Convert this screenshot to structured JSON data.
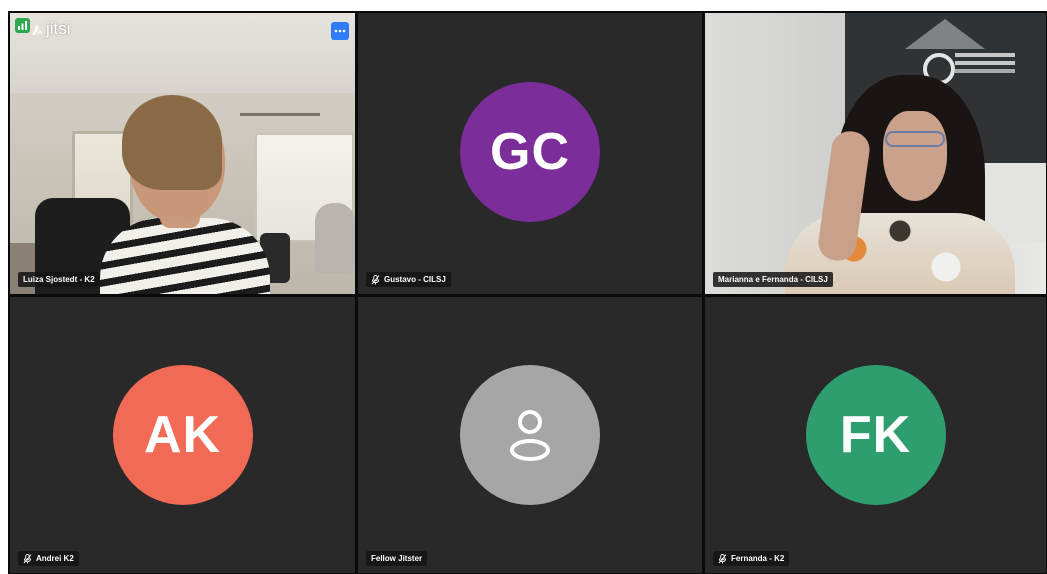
{
  "participants": [
    {
      "name": "Luiza Sjostedt - K2",
      "mic_muted": false,
      "video": true
    },
    {
      "name": "Gustavo - CILSJ",
      "initials": "GC",
      "avatar_color": "#7b2d9a",
      "mic_muted": true,
      "video": false
    },
    {
      "name": "Marianna e Fernanda - CILSJ",
      "mic_muted": false,
      "video": true,
      "active_speaker": true
    },
    {
      "name": "Andrei K2",
      "initials": "AK",
      "avatar_color": "#f06a55",
      "mic_muted": true,
      "video": false
    },
    {
      "name": "Fellow Jitster",
      "avatar_color": "#a6a6a6",
      "avatar_icon": "user-icon",
      "mic_muted": false,
      "video": false
    },
    {
      "name": "Fernanda - K2",
      "initials": "FK",
      "avatar_color": "#2e9e6e",
      "mic_muted": true,
      "video": false
    }
  ],
  "watermark": {
    "text": "jitsi"
  },
  "colors": {
    "stage_background": "#0a0a0a",
    "tile_background": "#292929",
    "active_border": "#5b9bd5",
    "signal_badge": "#2fa84f",
    "more_button": "#2e7cf6"
  }
}
